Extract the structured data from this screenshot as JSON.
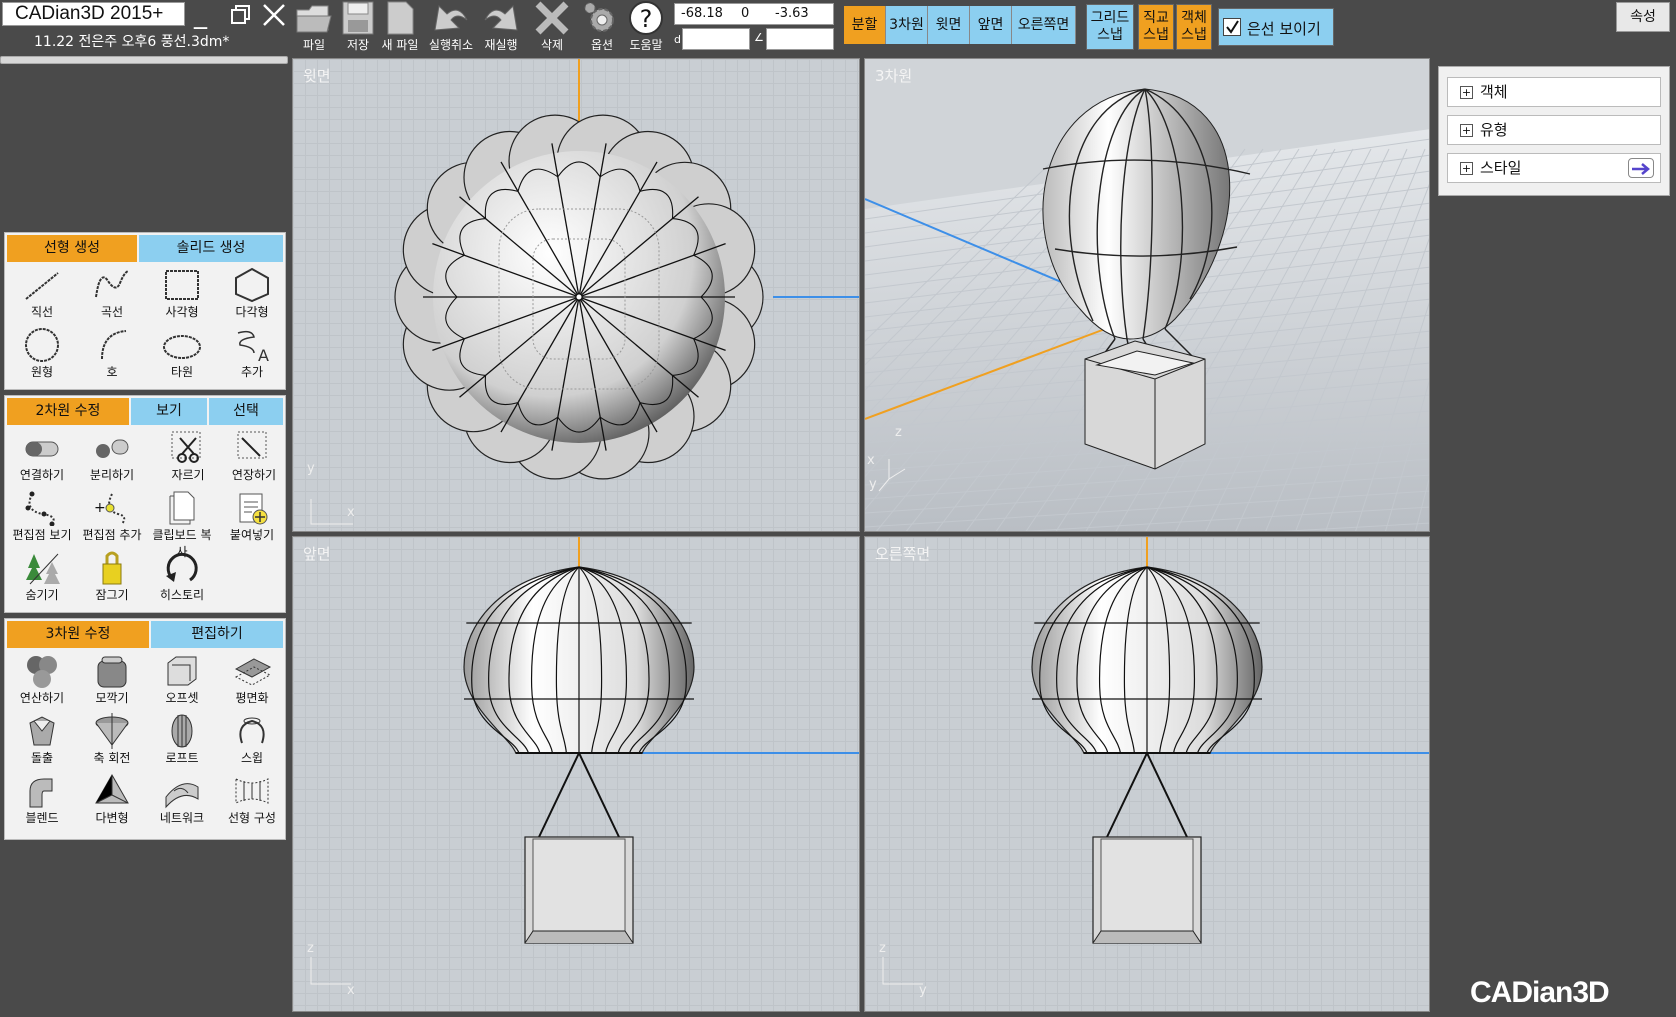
{
  "app": {
    "title": "CADian3D 2015+",
    "file": "11.22 전은주 오후6 풍선.3dm*",
    "logo": "CADian3D"
  },
  "toolbar": [
    {
      "id": "open",
      "label": "파일",
      "icon": "folder-icon"
    },
    {
      "id": "save",
      "label": "저장",
      "icon": "floppy-icon"
    },
    {
      "id": "new",
      "label": "새 파일",
      "icon": "page-icon"
    },
    {
      "id": "undo",
      "label": "실행취소",
      "icon": "undo-icon"
    },
    {
      "id": "redo",
      "label": "재실행",
      "icon": "redo-icon"
    },
    {
      "id": "delete",
      "label": "삭제",
      "icon": "x-icon"
    },
    {
      "id": "options",
      "label": "옵션",
      "icon": "gear-icon"
    },
    {
      "id": "help",
      "label": "도움말",
      "icon": "question-icon"
    }
  ],
  "coords": {
    "x": "-68.18",
    "y": "0",
    "z": "-3.63",
    "dist_sym": "d",
    "angle_sym": "∠",
    "dist": "",
    "angle": ""
  },
  "view_buttons": [
    {
      "label": "분할",
      "active": true
    },
    {
      "label": "3차원",
      "active": false
    },
    {
      "label": "윗면",
      "active": false
    },
    {
      "label": "앞면",
      "active": false
    },
    {
      "label": "오른쪽면",
      "active": false
    }
  ],
  "snaps": [
    {
      "line1": "그리드",
      "line2": "스냅",
      "active": false
    },
    {
      "line1": "직교",
      "line2": "스냅",
      "active": true
    },
    {
      "line1": "객체",
      "line2": "스냅",
      "active": true
    }
  ],
  "hidden_lines": {
    "label": "은선 보이기",
    "checked": true
  },
  "properties_button": "속성",
  "panel1": {
    "tabs": [
      {
        "label": "선형 생성",
        "active": true
      },
      {
        "label": "솔리드 생성",
        "active": false
      }
    ],
    "tools": [
      {
        "label": "직선",
        "icon": "line-icon"
      },
      {
        "label": "곡선",
        "icon": "curve-icon"
      },
      {
        "label": "사각형",
        "icon": "rectangle-icon"
      },
      {
        "label": "다각형",
        "icon": "polygon-icon"
      },
      {
        "label": "원형",
        "icon": "circle-icon"
      },
      {
        "label": "호",
        "icon": "arc-icon"
      },
      {
        "label": "타원",
        "icon": "ellipse-icon"
      },
      {
        "label": "추가",
        "icon": "more-icon"
      }
    ]
  },
  "panel2": {
    "tabs": [
      {
        "label": "2차원 수정",
        "active": true
      },
      {
        "label": "보기",
        "active": false
      },
      {
        "label": "선택",
        "active": false
      }
    ],
    "tools": [
      {
        "label": "연결하기",
        "icon": "join-icon"
      },
      {
        "label": "분리하기",
        "icon": "explode-icon"
      },
      {
        "label": "자르기",
        "icon": "trim-icon"
      },
      {
        "label": "연장하기",
        "icon": "extend-icon"
      },
      {
        "label": "편집점 보기",
        "icon": "show-points-icon"
      },
      {
        "label": "편집점 추가",
        "icon": "add-point-icon"
      },
      {
        "label": "클립보드 복사",
        "icon": "copy-icon"
      },
      {
        "label": "붙여넣기",
        "icon": "paste-icon"
      },
      {
        "label": "숨기기",
        "icon": "hide-icon"
      },
      {
        "label": "잠그기",
        "icon": "lock-icon"
      },
      {
        "label": "히스토리",
        "icon": "history-icon"
      }
    ]
  },
  "panel3": {
    "tabs": [
      {
        "label": "3차원 수정",
        "active": true
      },
      {
        "label": "편집하기",
        "active": false
      }
    ],
    "tools": [
      {
        "label": "연산하기",
        "icon": "boolean-icon"
      },
      {
        "label": "모깍기",
        "icon": "fillet-icon"
      },
      {
        "label": "오프셋",
        "icon": "offset-icon"
      },
      {
        "label": "평면화",
        "icon": "flatten-icon"
      },
      {
        "label": "돌출",
        "icon": "extrude-icon"
      },
      {
        "label": "축 회전",
        "icon": "revolve-icon"
      },
      {
        "label": "로프트",
        "icon": "loft-icon"
      },
      {
        "label": "스윕",
        "icon": "sweep-icon"
      },
      {
        "label": "블렌드",
        "icon": "blend-icon"
      },
      {
        "label": "다변형",
        "icon": "polysurface-icon"
      },
      {
        "label": "네트워크",
        "icon": "network-icon"
      },
      {
        "label": "선형 구성",
        "icon": "curve-build-icon"
      }
    ]
  },
  "viewports": [
    {
      "id": "top",
      "label": "윗면",
      "ax1": "y",
      "ax2": "x"
    },
    {
      "id": "persp",
      "label": "3차원",
      "ax1": "z",
      "ax2": "x",
      "ax3": "y"
    },
    {
      "id": "front",
      "label": "앞면",
      "ax1": "z",
      "ax2": "x"
    },
    {
      "id": "right",
      "label": "오른쪽면",
      "ax1": "z",
      "ax2": "y"
    }
  ],
  "right_panel": [
    {
      "label": "객체"
    },
    {
      "label": "유형"
    },
    {
      "label": "스타일"
    }
  ],
  "colors": {
    "accent_orange": "#f0a020",
    "accent_blue": "#8ccff0",
    "axis_blue": "#3d8fe8",
    "axis_orange": "#f0a020",
    "viewport_bg": "#c9ced3"
  }
}
